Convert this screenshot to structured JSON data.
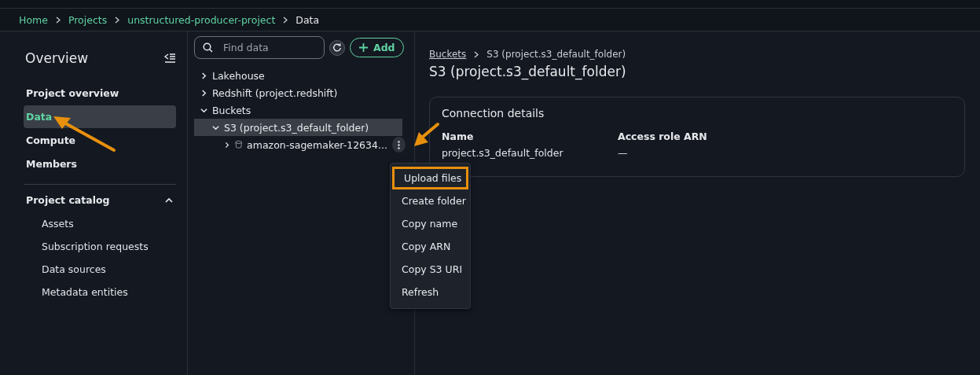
{
  "breadcrumb": [
    {
      "label": "Home",
      "link": true
    },
    {
      "label": "Projects",
      "link": true
    },
    {
      "label": "unstructured-producer-project",
      "link": true
    },
    {
      "label": "Data",
      "link": false
    }
  ],
  "sidebar": {
    "title": "Overview",
    "items": [
      {
        "label": "Project overview",
        "selected": false
      },
      {
        "label": "Data",
        "selected": true
      },
      {
        "label": "Compute",
        "selected": false
      },
      {
        "label": "Members",
        "selected": false
      }
    ],
    "catalog": {
      "title": "Project catalog",
      "expanded": true,
      "items": [
        "Assets",
        "Subscription requests",
        "Data sources",
        "Metadata entities"
      ]
    }
  },
  "tree": {
    "search": {
      "placeholder": "Find data"
    },
    "add_button": "Add",
    "nodes": [
      {
        "label": "Lakehouse",
        "expanded": false,
        "selected": false
      },
      {
        "label": "Redshift (project.redshift)",
        "expanded": false,
        "selected": false
      },
      {
        "label": "Buckets",
        "expanded": true,
        "selected": false,
        "children": [
          {
            "label": "S3 (project.s3_default_folder)",
            "expanded": true,
            "selected": true,
            "children": [
              {
                "label": "amazon-sagemaker-12634...",
                "expanded": false,
                "selected": false,
                "kind": "bucket"
              }
            ]
          }
        ]
      }
    ]
  },
  "menu": [
    {
      "label": "Upload files",
      "highlighted": true
    },
    {
      "label": "Create folder",
      "highlighted": false
    },
    {
      "label": "Copy name",
      "highlighted": false
    },
    {
      "label": "Copy ARN",
      "highlighted": false
    },
    {
      "label": "Copy S3 URI",
      "highlighted": false
    },
    {
      "label": "Refresh",
      "highlighted": false
    }
  ],
  "detail": {
    "breadcrumb": [
      {
        "label": "Buckets",
        "link": true
      },
      {
        "label": "S3 (project.s3_default_folder)",
        "link": false
      }
    ],
    "title": "S3 (project.s3_default_folder)",
    "card": {
      "title": "Connection details",
      "fields": [
        {
          "label": "Name",
          "value": "project.s3_default_folder"
        },
        {
          "label": "Access role ARN",
          "value": "—"
        }
      ]
    }
  }
}
